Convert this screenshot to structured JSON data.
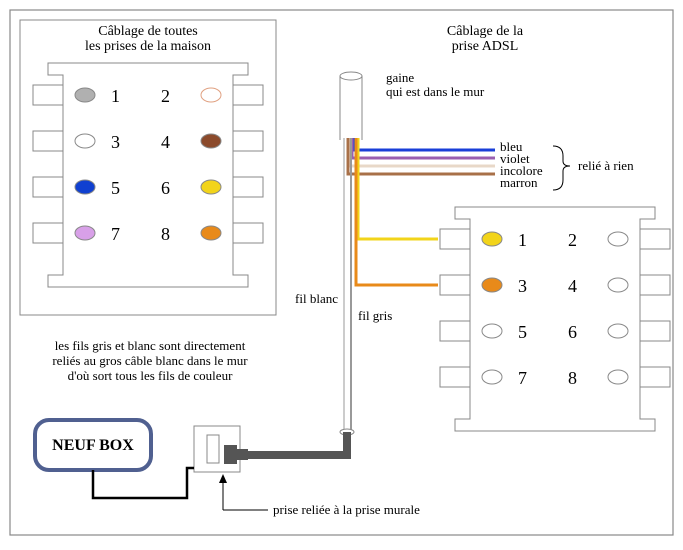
{
  "left": {
    "title1": "Câblage de toutes",
    "title2": "les prises de la maison",
    "pins": [
      {
        "n": "1",
        "fill": "#b0b0b0"
      },
      {
        "n": "2",
        "fill": "none"
      },
      {
        "n": "3",
        "fill": "#ffffff"
      },
      {
        "n": "4",
        "fill": "#8b4a2b"
      },
      {
        "n": "5",
        "fill": "#1040d0"
      },
      {
        "n": "6",
        "fill": "#f2d41a"
      },
      {
        "n": "7",
        "fill": "#d8a0e8"
      },
      {
        "n": "8",
        "fill": "#e88a1a"
      }
    ]
  },
  "right": {
    "title1": "Câblage de la",
    "title2": "prise ADSL",
    "pins": [
      {
        "n": "1",
        "fill": "#f2d41a"
      },
      {
        "n": "2",
        "fill": "none"
      },
      {
        "n": "3",
        "fill": "#e88a1a"
      },
      {
        "n": "4",
        "fill": "none"
      },
      {
        "n": "5",
        "fill": "none"
      },
      {
        "n": "6",
        "fill": "none"
      },
      {
        "n": "7",
        "fill": "none"
      },
      {
        "n": "8",
        "fill": "none"
      }
    ]
  },
  "labels": {
    "gaine1": "gaine",
    "gaine2": "qui est dans le mur",
    "wires": [
      "bleu",
      "violet",
      "incolore",
      "marron"
    ],
    "relie": "relié à rien",
    "filblanc": "fil blanc",
    "filgris": "fil gris",
    "note1": "les fils gris et blanc sont directement",
    "note2": "reliés au gros câble blanc dans le mur",
    "note3": "d'où sort tous les fils de couleur",
    "neuf": "NEUF BOX",
    "prise": "prise reliée à la prise murale"
  }
}
